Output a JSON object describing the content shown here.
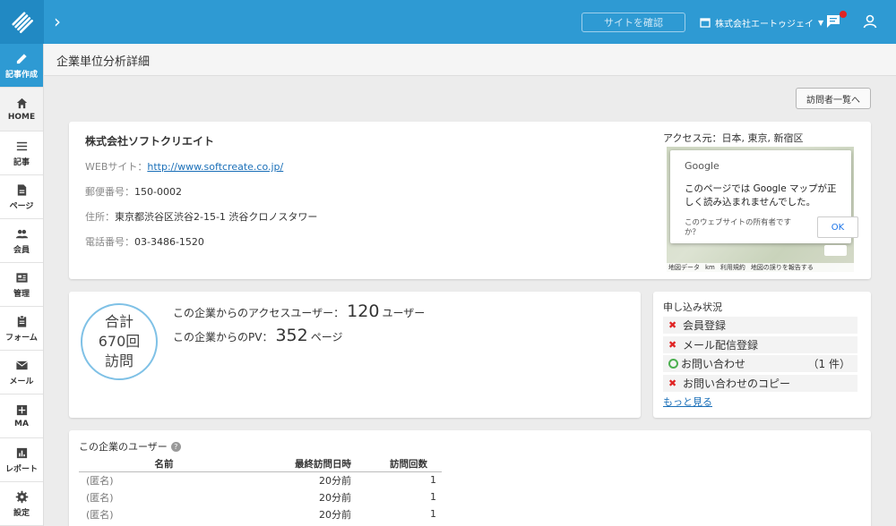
{
  "header": {
    "site_button": "サイトを確認",
    "company": "株式会社エートゥジェイ"
  },
  "sidebar": {
    "items": [
      {
        "label": "記事作成",
        "icon": "pencil-icon"
      },
      {
        "label": "HOME",
        "icon": "home-icon"
      },
      {
        "label": "記事",
        "icon": "list-icon"
      },
      {
        "label": "ページ",
        "icon": "page-icon"
      },
      {
        "label": "会員",
        "icon": "people-icon"
      },
      {
        "label": "管理",
        "icon": "manage-icon"
      },
      {
        "label": "フォーム",
        "icon": "clipboard-icon"
      },
      {
        "label": "メール",
        "icon": "mail-icon"
      },
      {
        "label": "MA",
        "icon": "ma-icon"
      },
      {
        "label": "レポート",
        "icon": "report-icon"
      },
      {
        "label": "設定",
        "icon": "gear-icon"
      }
    ]
  },
  "page": {
    "title": "企業単位分析詳細",
    "visitors_button": "訪問者一覧へ"
  },
  "company": {
    "name": "株式会社ソフトクリエイト",
    "website_label": "WEBサイト：",
    "website": "http://www.softcreate.co.jp/",
    "postal_label": "郵便番号：",
    "postal": "150-0002",
    "address_label": "住所：",
    "address": "東京都渋谷区渋谷2-15-1 渋谷クロノスタワー",
    "phone_label": "電話番号：",
    "phone": "03-3486-1520",
    "access_label": "アクセス元：",
    "access": "日本, 東京, 新宿区"
  },
  "map": {
    "google": "Google",
    "message": "このページでは Google マップが正しく読み込まれませんでした。",
    "owner_q": "このウェブサイトの所有者ですか？",
    "ok": "OK",
    "footer": [
      "地図データ",
      "km",
      "利用規約",
      "地図の誤りを報告する"
    ]
  },
  "visits": {
    "circle_line1": "合計",
    "circle_line2": "670回",
    "circle_line3": "訪問",
    "users_prefix": "この企業からのアクセスユーザー：",
    "users_count": "120",
    "users_unit": "ユーザー",
    "pv_prefix": "この企業からのPV：",
    "pv_count": "352",
    "pv_unit": "ページ"
  },
  "status": {
    "title": "申し込み状況",
    "items": [
      {
        "label": "会員登録",
        "state": "x",
        "count": ""
      },
      {
        "label": "メール配信登録",
        "state": "x",
        "count": ""
      },
      {
        "label": "お問い合わせ",
        "state": "o",
        "count": "（1 件）"
      },
      {
        "label": "お問い合わせのコピー",
        "state": "x",
        "count": ""
      }
    ],
    "more": "もっと見る"
  },
  "users": {
    "title": "この企業のユーザー",
    "help": "?",
    "columns": [
      "名前",
      "最終訪問日時",
      "訪問回数"
    ],
    "rows": [
      {
        "name": "(匿名)",
        "last": "20分前",
        "count": "1"
      },
      {
        "name": "(匿名)",
        "last": "20分前",
        "count": "1"
      },
      {
        "name": "(匿名)",
        "last": "20分前",
        "count": "1"
      }
    ]
  }
}
